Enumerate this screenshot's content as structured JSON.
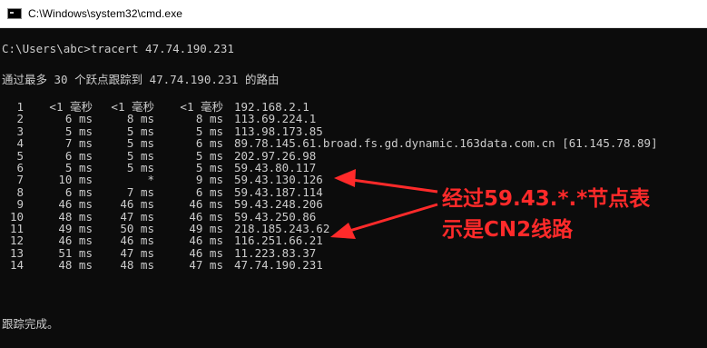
{
  "window": {
    "title": "C:\\Windows\\system32\\cmd.exe"
  },
  "console": {
    "command_line": "C:\\Users\\abc>tracert 47.74.190.231",
    "header_line": "通过最多 30 个跃点跟踪到 47.74.190.231 的路由",
    "footer_line": "跟踪完成。",
    "hops": [
      {
        "n": "1",
        "t1": "<1 毫秒",
        "t2": "<1 毫秒",
        "t3": "<1 毫秒",
        "host": "192.168.2.1"
      },
      {
        "n": "2",
        "t1": "6 ms",
        "t2": "8 ms",
        "t3": "8 ms",
        "host": "113.69.224.1"
      },
      {
        "n": "3",
        "t1": "5 ms",
        "t2": "5 ms",
        "t3": "5 ms",
        "host": "113.98.173.85"
      },
      {
        "n": "4",
        "t1": "7 ms",
        "t2": "5 ms",
        "t3": "6 ms",
        "host": "89.78.145.61.broad.fs.gd.dynamic.163data.com.cn [61.145.78.89]"
      },
      {
        "n": "5",
        "t1": "6 ms",
        "t2": "5 ms",
        "t3": "5 ms",
        "host": "202.97.26.98"
      },
      {
        "n": "6",
        "t1": "5 ms",
        "t2": "5 ms",
        "t3": "5 ms",
        "host": "59.43.80.117"
      },
      {
        "n": "7",
        "t1": "10 ms",
        "t2": "*",
        "t3": "9 ms",
        "host": "59.43.130.126"
      },
      {
        "n": "8",
        "t1": "6 ms",
        "t2": "7 ms",
        "t3": "6 ms",
        "host": "59.43.187.114"
      },
      {
        "n": "9",
        "t1": "46 ms",
        "t2": "46 ms",
        "t3": "46 ms",
        "host": "59.43.248.206"
      },
      {
        "n": "10",
        "t1": "48 ms",
        "t2": "47 ms",
        "t3": "46 ms",
        "host": "59.43.250.86"
      },
      {
        "n": "11",
        "t1": "49 ms",
        "t2": "50 ms",
        "t3": "49 ms",
        "host": "218.185.243.62"
      },
      {
        "n": "12",
        "t1": "46 ms",
        "t2": "46 ms",
        "t3": "46 ms",
        "host": "116.251.66.21"
      },
      {
        "n": "13",
        "t1": "51 ms",
        "t2": "47 ms",
        "t3": "46 ms",
        "host": "11.223.83.37"
      },
      {
        "n": "14",
        "t1": "48 ms",
        "t2": "48 ms",
        "t3": "47 ms",
        "host": "47.74.190.231"
      }
    ]
  },
  "annotation": {
    "line1": "经过59.43.*.*节点表",
    "line2": "示是CN2线路",
    "color": "#ff2a2a"
  },
  "colors": {
    "console_bg": "#0c0c0c",
    "console_text": "#cccccc",
    "annotation": "#ff2a2a"
  }
}
